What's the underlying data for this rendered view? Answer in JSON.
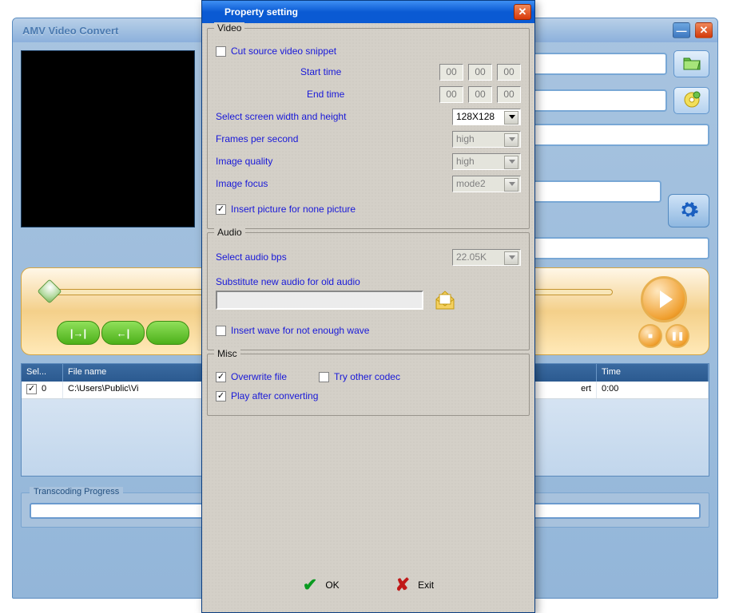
{
  "mainWindow": {
    "title": "AMV Video Convert"
  },
  "transport": {
    "btn1": "|→|",
    "btn2": "←|"
  },
  "grid": {
    "headers": {
      "sel": "Sel...",
      "file": "File name",
      "status": "",
      "time": "Time"
    },
    "row0": {
      "idx": "0",
      "file": "C:\\Users\\Public\\Vi",
      "status": "ert",
      "time": "0:00"
    }
  },
  "progress": {
    "label": "Transcoding Progress"
  },
  "dialog": {
    "title": "Property setting",
    "video": {
      "legend": "Video",
      "cutSnippet": "Cut source video snippet",
      "startTime": "Start time",
      "endTime": "End time",
      "start": {
        "h": "00",
        "m": "00",
        "s": "00"
      },
      "end": {
        "h": "00",
        "m": "00",
        "s": "00"
      },
      "screenLabel": "Select screen width and height",
      "screenValue": "128X128",
      "fpsLabel": "Frames per second",
      "fpsValue": "high",
      "qualityLabel": "Image quality",
      "qualityValue": "high",
      "focusLabel": "Image focus",
      "focusValue": "mode2",
      "insertPicture": "Insert picture for none picture"
    },
    "audio": {
      "legend": "Audio",
      "bpsLabel": "Select audio bps",
      "bpsValue": "22.05K",
      "substituteLabel": "Substitute new audio for old audio",
      "insertWave": "Insert wave for not enough wave"
    },
    "misc": {
      "legend": "Misc",
      "overwrite": "Overwrite file",
      "tryCodec": "Try other codec",
      "playAfter": "Play after converting"
    },
    "buttons": {
      "ok": "OK",
      "exit": "Exit"
    }
  }
}
